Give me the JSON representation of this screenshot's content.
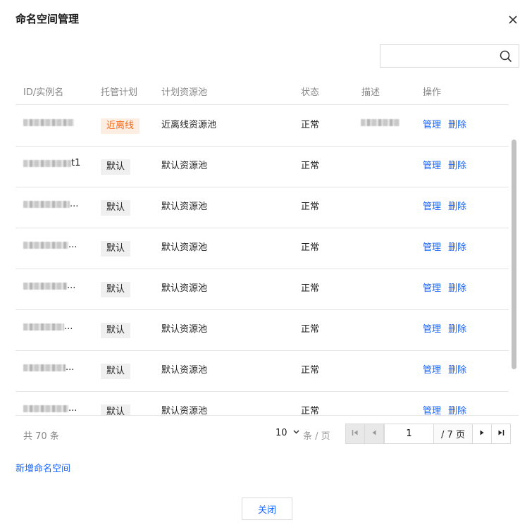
{
  "dialog": {
    "title": "命名空间管理"
  },
  "search": {
    "placeholder": ""
  },
  "table": {
    "columns": [
      "ID/实例名",
      "托管计划",
      "计划资源池",
      "状态",
      "描述",
      "操作"
    ],
    "rows": [
      {
        "id": "",
        "plan": "近离线",
        "plan_variant": "offline",
        "pool": "近离线资源池",
        "status": "正常",
        "desc_blurred": true,
        "manage": "管理",
        "delete": "删除"
      },
      {
        "id": "t1",
        "plan": "默认",
        "plan_variant": "default",
        "pool": "默认资源池",
        "status": "正常",
        "desc_blurred": false,
        "manage": "管理",
        "delete": "删除"
      },
      {
        "id": "...",
        "plan": "默认",
        "plan_variant": "default",
        "pool": "默认资源池",
        "status": "正常",
        "desc_blurred": false,
        "manage": "管理",
        "delete": "删除"
      },
      {
        "id": "...",
        "plan": "默认",
        "plan_variant": "default",
        "pool": "默认资源池",
        "status": "正常",
        "desc_blurred": false,
        "manage": "管理",
        "delete": "删除"
      },
      {
        "id": "...",
        "plan": "默认",
        "plan_variant": "default",
        "pool": "默认资源池",
        "status": "正常",
        "desc_blurred": false,
        "manage": "管理",
        "delete": "删除"
      },
      {
        "id": "...",
        "plan": "默认",
        "plan_variant": "default",
        "pool": "默认资源池",
        "status": "正常",
        "desc_blurred": false,
        "manage": "管理",
        "delete": "删除"
      },
      {
        "id": "...",
        "plan": "默认",
        "plan_variant": "default",
        "pool": "默认资源池",
        "status": "正常",
        "desc_blurred": false,
        "manage": "管理",
        "delete": "删除"
      },
      {
        "id": "...",
        "plan": "默认",
        "plan_variant": "default",
        "pool": "默认资源池",
        "status": "正常",
        "desc_blurred": false,
        "manage": "管理",
        "delete": "删除"
      }
    ]
  },
  "pagination": {
    "total_label": "共 70 条",
    "page_size": "10",
    "per_page_label": "条 / 页",
    "current_page": "1",
    "total_pages_label": "/ 7 页"
  },
  "actions": {
    "add_namespace": "新增命名空间",
    "close": "关闭"
  },
  "icons": {
    "close": "close-icon",
    "search": "search-icon",
    "first": "first-page-icon",
    "prev": "prev-page-icon",
    "next": "next-page-icon",
    "last": "last-page-icon",
    "chevron": "chevron-down-icon"
  },
  "colors": {
    "link": "#1664ff",
    "offline_tag_bg": "#fdeee4",
    "offline_tag_text": "#f26a1b",
    "default_tag_bg": "#f0f0f0"
  }
}
